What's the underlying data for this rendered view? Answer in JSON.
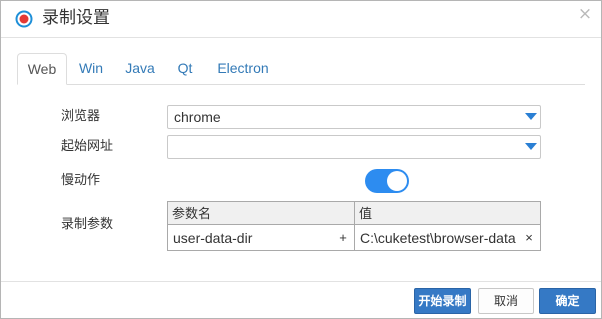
{
  "dialog": {
    "title": "录制设置",
    "close_symbol": "×",
    "icon": "record-icon",
    "colors": {
      "accent": "#2d8cf0",
      "record_red": "#e53935",
      "link_blue": "#337ab7",
      "primary_button": "#3579c5"
    }
  },
  "tabs": [
    {
      "label": "Web",
      "active": true
    },
    {
      "label": "Win",
      "active": false
    },
    {
      "label": "Java",
      "active": false
    },
    {
      "label": "Qt",
      "active": false
    },
    {
      "label": "Electron",
      "active": false
    }
  ],
  "form": {
    "browser": {
      "label": "浏览器",
      "value": "chrome"
    },
    "start_url": {
      "label": "起始网址",
      "value": ""
    },
    "slow_motion": {
      "label": "慢动作",
      "enabled": true
    },
    "params": {
      "label": "录制参数",
      "columns": [
        "参数名",
        "值"
      ],
      "rows": [
        {
          "name": "user-data-dir",
          "value": "C:\\cuketest\\browser-data",
          "add_symbol": "+",
          "remove_symbol": "×"
        }
      ]
    }
  },
  "footer": {
    "start_label": "开始录制",
    "cancel_label": "取消",
    "ok_label": "确定"
  }
}
